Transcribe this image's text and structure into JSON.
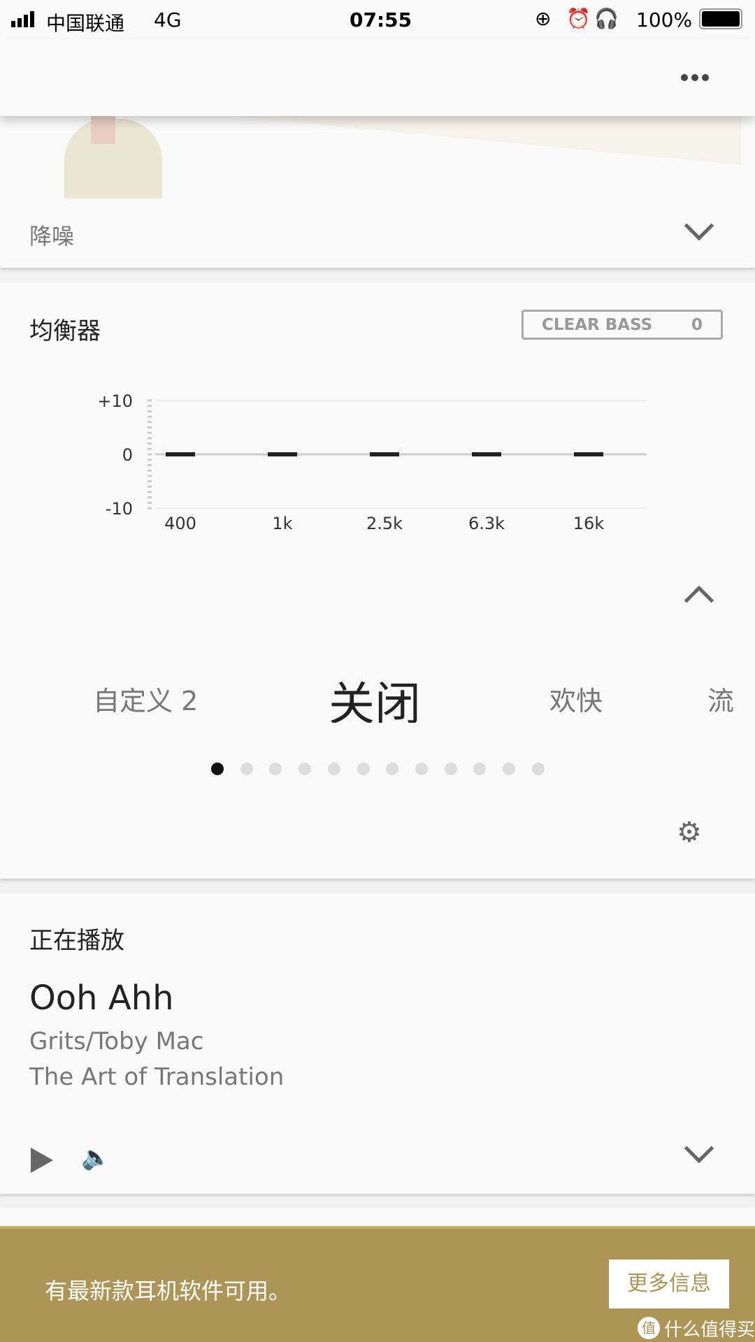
{
  "status_bar": {
    "carrier": "中国联通",
    "network": "4G",
    "time": "07:55",
    "battery": "100%"
  },
  "header": {
    "more_icon": "more-horizontal-icon"
  },
  "noise_card": {
    "label": "降噪"
  },
  "eq_card": {
    "title": "均衡器",
    "clear_bass_label": "CLEAR BASS",
    "clear_bass_value": "0",
    "presets": {
      "prev": "自定义 2",
      "current": "关闭",
      "next": "欢快",
      "partial": "流"
    },
    "page_count": 12,
    "active_page": 0
  },
  "chart_data": {
    "type": "bar",
    "categories": [
      "400",
      "1k",
      "2.5k",
      "6.3k",
      "16k"
    ],
    "values": [
      0,
      0,
      0,
      0,
      0
    ],
    "yticks": [
      "+10",
      "0",
      "-10"
    ],
    "ylim": [
      -10,
      10
    ],
    "grid": true
  },
  "now_playing": {
    "title": "正在播放",
    "track": "Ooh Ahh",
    "artist": "Grits/Toby Mac",
    "album": "The Art of Translation"
  },
  "banner": {
    "message": "有最新款耳机软件可用。",
    "button": "更多信息",
    "accent": "#ad9558"
  },
  "watermark": {
    "text": "什么值得买",
    "badge": "值"
  }
}
